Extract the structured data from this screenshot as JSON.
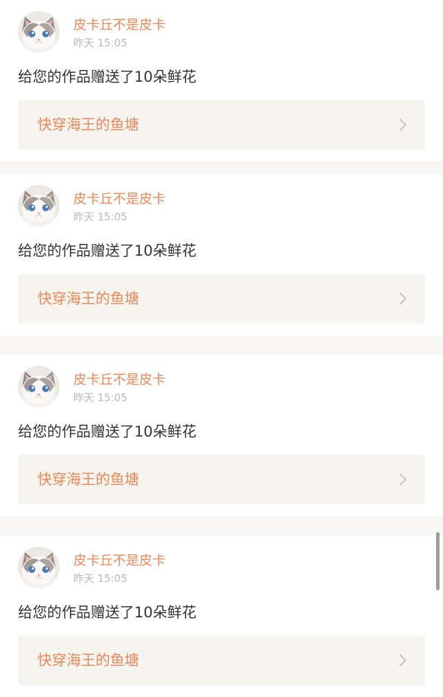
{
  "notifications": [
    {
      "username": "皮卡丘不是皮卡",
      "time": "昨天 15:05",
      "message": "给您的作品赠送了10朵鲜花",
      "work_title": "快穿海王的鱼塘"
    },
    {
      "username": "皮卡丘不是皮卡",
      "time": "昨天 15:05",
      "message": "给您的作品赠送了10朵鲜花",
      "work_title": "快穿海王的鱼塘"
    },
    {
      "username": "皮卡丘不是皮卡",
      "time": "昨天 15:05",
      "message": "给您的作品赠送了10朵鲜花",
      "work_title": "快穿海王的鱼塘"
    },
    {
      "username": "皮卡丘不是皮卡",
      "time": "昨天 15:05",
      "message": "给您的作品赠送了10朵鲜花",
      "work_title": "快穿海王的鱼塘"
    }
  ],
  "icons": {
    "avatar": "cat-avatar-icon",
    "chevron": "chevron-right-icon"
  },
  "colors": {
    "accent": "#e8895a",
    "card_background": "#ffffff",
    "page_background": "#f7f6f4",
    "link_background": "#f5f4ee",
    "secondary_text": "#b9b9b9",
    "primary_text": "#333333"
  }
}
